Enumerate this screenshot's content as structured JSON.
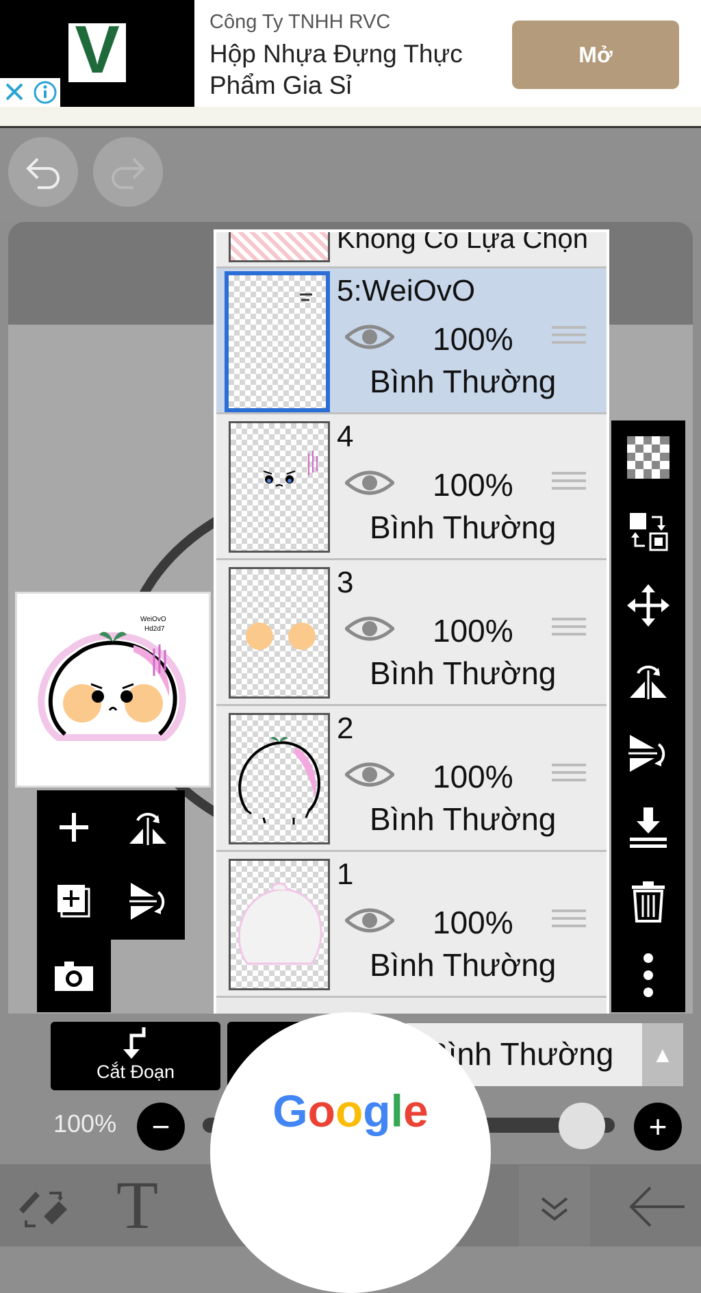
{
  "ad": {
    "logo_letter": "V",
    "company": "Công Ty TNHH RVC",
    "headline": "Hộp Nhựa Đựng Thực Phẩm Gia Sỉ",
    "cta": "Mở"
  },
  "layers_panel": {
    "selection_row": "Không Có Lựa Chọn",
    "layers": [
      {
        "name": "5:WeiOvO",
        "opacity": "100%",
        "blend": "Bình Thường",
        "selected": true
      },
      {
        "name": "4",
        "opacity": "100%",
        "blend": "Bình Thường",
        "selected": false
      },
      {
        "name": "3",
        "opacity": "100%",
        "blend": "Bình Thường",
        "selected": false
      },
      {
        "name": "2",
        "opacity": "100%",
        "blend": "Bình Thường",
        "selected": false
      },
      {
        "name": "1",
        "opacity": "100%",
        "blend": "Bình Thường",
        "selected": false
      }
    ]
  },
  "preview": {
    "sticker_text_line1": "WeiOvO",
    "sticker_text_line2": "Hd2d7"
  },
  "bottom": {
    "cut_label": "Cắt Đoạn",
    "blend_mode": "Bình Thường",
    "zoom": "100%",
    "opacity_fraction": 0.92
  },
  "google_overlay": {
    "letters": [
      "G",
      "o",
      "o",
      "g",
      "l",
      "e"
    ],
    "colors": [
      "#4285F4",
      "#EA4335",
      "#FBBC05",
      "#4285F4",
      "#34A853",
      "#EA4335"
    ]
  },
  "colors": {
    "selected_layer_bg": "#c8d6ea",
    "selected_border": "#2b6fd6",
    "ad_button": "#b39b7b",
    "ad_logo_green": "#1f6a3a"
  }
}
